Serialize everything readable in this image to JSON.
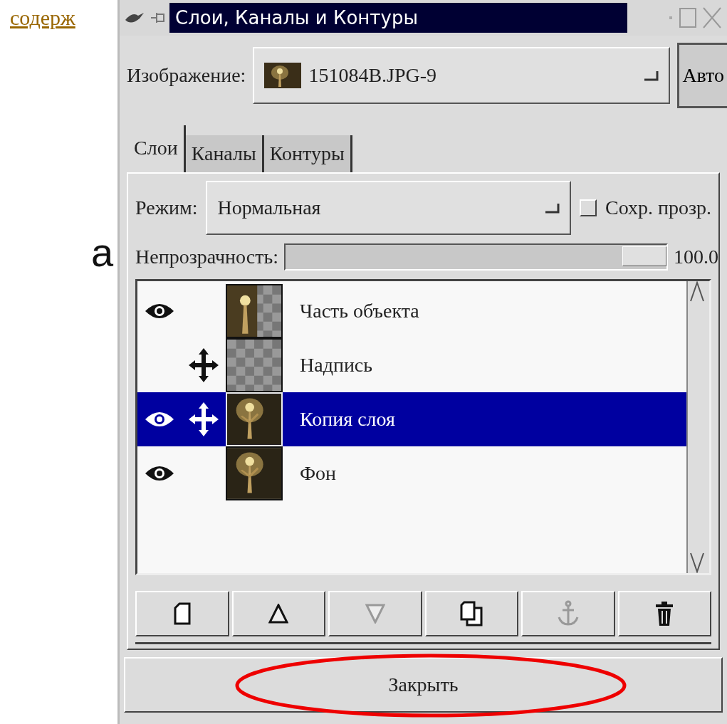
{
  "page_link": "содерж",
  "page_letter": "а",
  "window": {
    "title": "Слои, Каналы и Контуры"
  },
  "image_selector": {
    "label": "Изображение:",
    "value": "151084B.JPG-9",
    "auto_button": "Авто"
  },
  "tabs": [
    {
      "label": "Слои",
      "selected": true
    },
    {
      "label": "Каналы",
      "selected": false
    },
    {
      "label": "Контуры",
      "selected": false
    }
  ],
  "mode": {
    "label": "Режим:",
    "value": "Нормальная"
  },
  "keep_transparency": {
    "label": "Сохр. прозр.",
    "checked": false
  },
  "opacity": {
    "label": "Непрозрачность:",
    "level": 1,
    "reading": "100.0"
  },
  "layers": [
    {
      "name": "Часть объекта",
      "visible": true,
      "linked": false,
      "selected": false,
      "kind": "partial"
    },
    {
      "name": "Надпись",
      "visible": false,
      "linked": true,
      "selected": false,
      "kind": "empty"
    },
    {
      "name": "Копия слоя",
      "visible": true,
      "linked": true,
      "selected": true
    },
    {
      "name": "Фон",
      "visible": true,
      "linked": false,
      "selected": false
    }
  ],
  "layer_buttons": [
    {
      "kind": "new",
      "disabled": false
    },
    {
      "kind": "raise",
      "disabled": false
    },
    {
      "kind": "lower",
      "disabled": true
    },
    {
      "kind": "duplicate",
      "disabled": false
    },
    {
      "kind": "anchor",
      "disabled": true
    },
    {
      "kind": "delete",
      "disabled": false
    }
  ],
  "close_button": {
    "label": "Закрыть",
    "highlighted": true
  }
}
